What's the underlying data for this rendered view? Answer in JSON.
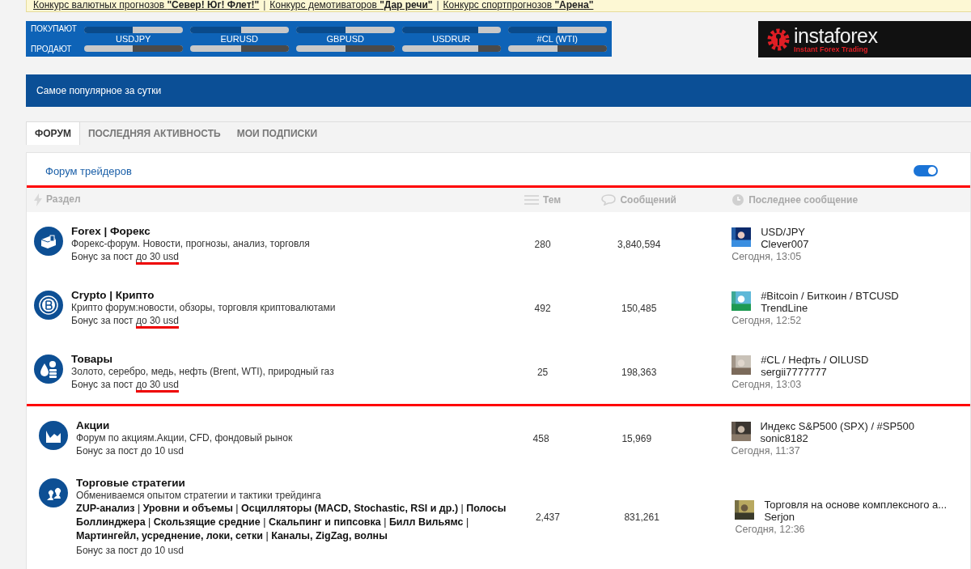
{
  "contests": {
    "separator": "|",
    "links": [
      {
        "text": "Конкурс валютных прогнозов **\"Север! Юг! Флет!\"**"
      },
      {
        "text": "Конкурс демотиваторов **\"Дар речи\"**"
      },
      {
        "text": "Конкурс спортпрогнозов **\"Арена\"**"
      }
    ]
  },
  "ticker": {
    "buy_label": "ПОКУПАЮТ",
    "sell_label": "ПРОДАЮТ",
    "pairs": [
      {
        "name": "USDJPY",
        "buy": {
          "level": 0.49
        },
        "sell": {
          "level": 0.51
        }
      },
      {
        "name": "EURUSD",
        "buy": {
          "level": 0.52
        },
        "sell": {
          "level": 0.48
        }
      },
      {
        "name": "GBPUSD",
        "buy": {
          "level": 0.5
        },
        "sell": {
          "level": 0.5
        }
      },
      {
        "name": "USDRUR",
        "buy": {
          "level": 0.77
        },
        "sell": {
          "level": 0.23
        }
      },
      {
        "name": "#CL (WTI)",
        "buy": {
          "level": 0.5
        },
        "sell": {
          "level": 0.5
        }
      }
    ]
  },
  "logo": {
    "name": "instaforex",
    "tagline": "Instant Forex Trading"
  },
  "banner": {
    "title": "Самое популярное за сутки"
  },
  "tabs": [
    {
      "label": "ФОРУМ",
      "selected": true
    },
    {
      "label": "ПОСЛЕДНЯЯ АКТИВНОСТЬ",
      "selected": false
    },
    {
      "label": "МОИ ПОДПИСКИ",
      "selected": false
    }
  ],
  "section": {
    "title": "Форум трейдеров",
    "toggle_on": true
  },
  "table": {
    "columns": [
      "Раздел",
      "Тем",
      "Сообщений",
      "Последнее сообщение"
    ],
    "rows": [
      {
        "kind": "money",
        "title": "Forex | Форекс",
        "description": "Форекс-форум. Новости, прогнозы, анализ, торговля",
        "bonus": "Бонус за пост",
        "bonus_amount": "до 30 usd",
        "underlined": true,
        "highlighted": true,
        "topics": "280",
        "posts": "3,840,594",
        "last": {
          "thread": "USD/JPY",
          "user": "Clever007",
          "time": "Сегодня, 13:05"
        }
      },
      {
        "kind": "bitcoin",
        "title": "Crypto | Крипто",
        "description": "Крипто форум:новости, обзоры, торговля криптовалютами",
        "bonus": "Бонус за пост",
        "bonus_amount": "до 30 usd",
        "underlined": true,
        "highlighted": true,
        "topics": "492",
        "posts": "150,485",
        "last": {
          "thread": "#Bitcoin / Биткоин / BTCUSD",
          "user": "TrendLine",
          "time": "Сегодня, 12:52"
        }
      },
      {
        "kind": "commodities",
        "title": "Товары",
        "description": "Золото, серебро, медь, нефть (Brent, WTI), природный газ",
        "bonus": "Бонус за пост",
        "bonus_amount": "до 30 usd",
        "underlined": true,
        "highlighted": true,
        "topics": "25",
        "posts": "198,363",
        "last": {
          "thread": "#CL / Нефть / OILUSD",
          "user": "sergii7777777",
          "time": "Сегодня, 13:03"
        }
      },
      {
        "kind": "chart",
        "title": "Акции",
        "description": "Форум по акциям.Акции, CFD, фондовый рынок",
        "bonus": "Бонус за пост",
        "bonus_amount": "до 10 usd",
        "underlined": false,
        "highlighted": false,
        "topics": "458",
        "posts": "15,969",
        "last": {
          "thread": "Индекс S&P500 (SPX) / #SP500",
          "user": "sonic8182",
          "time": "Сегодня, 11:37"
        }
      },
      {
        "kind": "chess",
        "title": "Торговые стратегии",
        "description": "Обмениваемся опытом стратегии и тактики трейдинга",
        "subforums": "**ZUP-анализ** | **Уровни и объемы** | **Осцилляторы (MACD, Stochastic, RSI и др.)** | **Полосы Боллинджера** | **Скользящие средние** | **Скальпинг и пипсовка** | **Билл Вильямс** | **Мартингейл, усреднение, локи, сетки** | **Каналы, ZigZag, волны**",
        "bonus": "Бонус за пост",
        "bonus_amount": "до 10 usd",
        "underlined": false,
        "highlighted": false,
        "topics": "2,437",
        "posts": "831,261",
        "last": {
          "thread": "Торговля на основе комплексного а...",
          "user": "Serjon",
          "time": "Сегодня, 12:36"
        }
      }
    ]
  }
}
